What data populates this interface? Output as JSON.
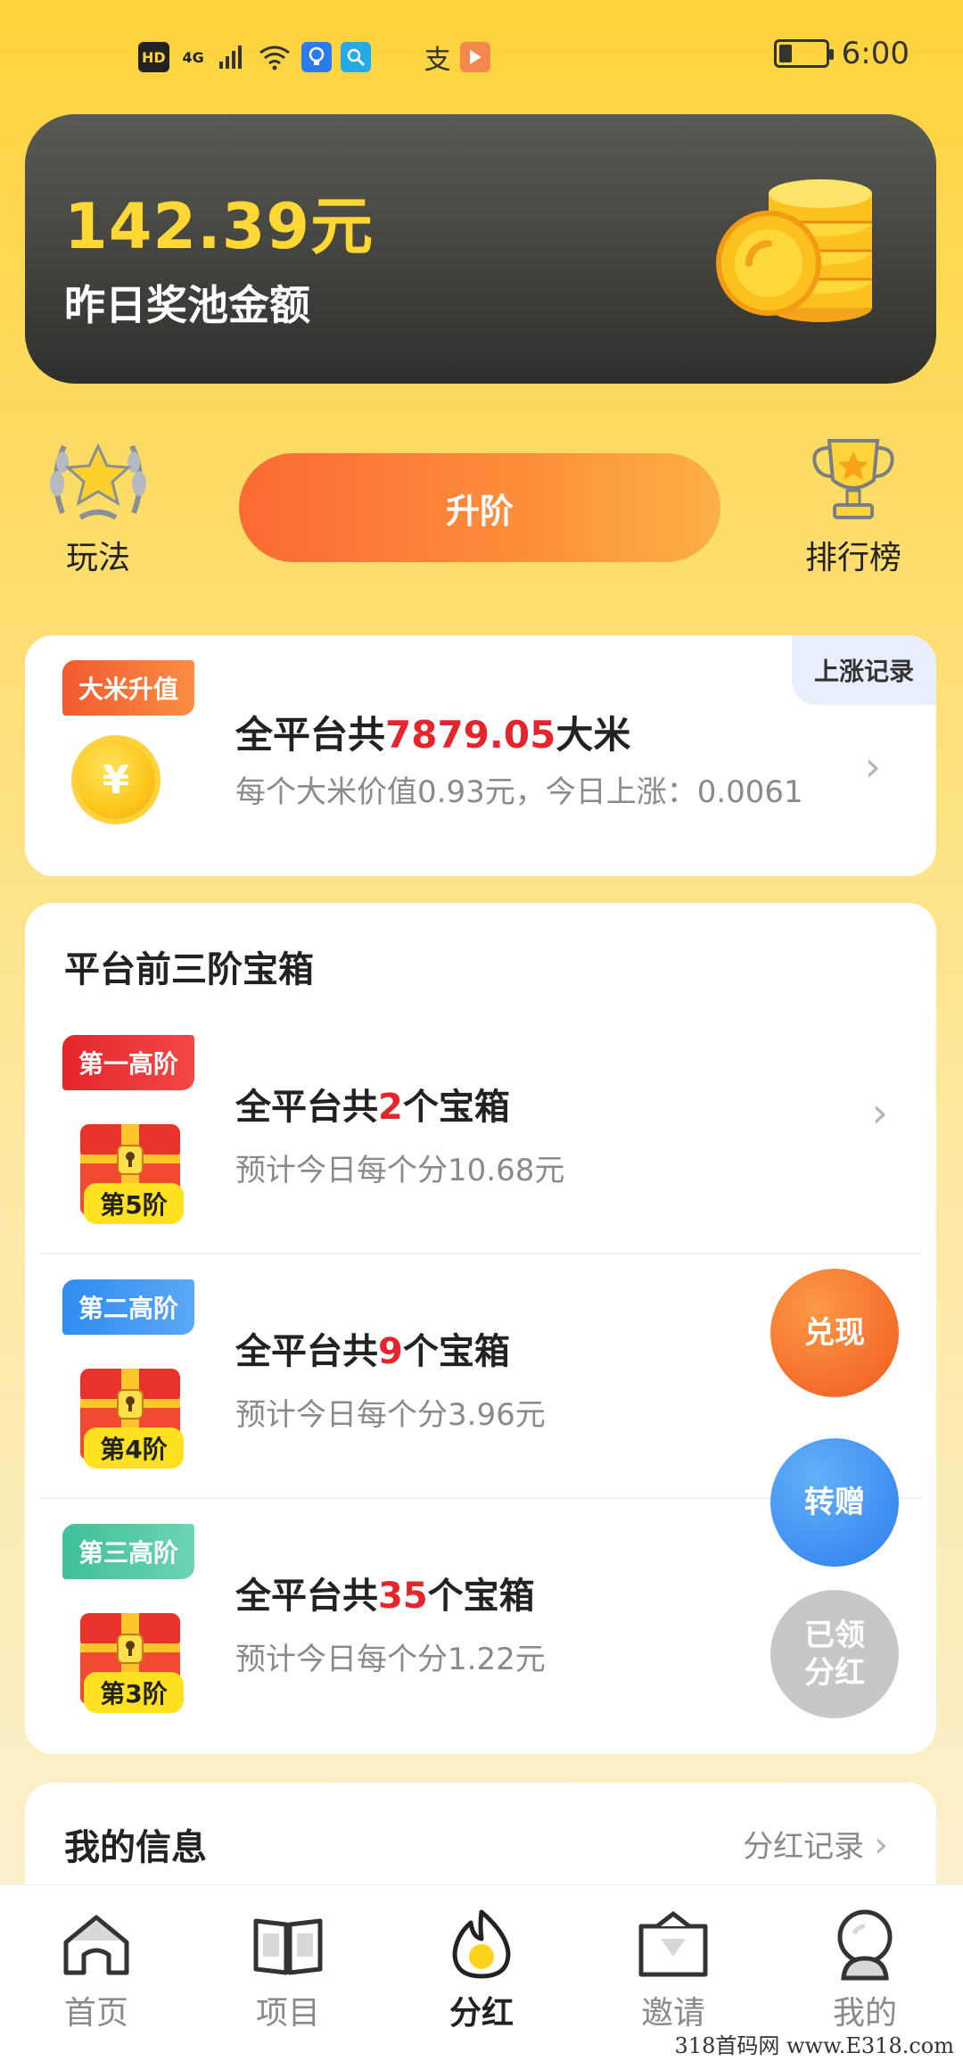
{
  "status_bar": {
    "left_badges": [
      "HD",
      "4G",
      "支"
    ],
    "time": "6:00"
  },
  "pool": {
    "amount": "142.39元",
    "label": "昨日奖池金额"
  },
  "actions": {
    "rules_label": "玩法",
    "upgrade_label": "升阶",
    "ranking_label": "排行榜"
  },
  "rice": {
    "tag": "大米升值",
    "rise_record": "上涨记录",
    "title_prefix": "全平台共",
    "total": "7879.05",
    "title_suffix": "大米",
    "subtitle": "每个大米价值0.93元，今日上涨：0.0061"
  },
  "chests": {
    "section_title": "平台前三阶宝箱",
    "rows": [
      {
        "tag": "第一高阶",
        "level": "第5阶",
        "title_prefix": "全平台共",
        "count": "2",
        "title_suffix": "个宝箱",
        "subtitle": "预计今日每个分10.68元"
      },
      {
        "tag": "第二高阶",
        "level": "第4阶",
        "title_prefix": "全平台共",
        "count": "9",
        "title_suffix": "个宝箱",
        "subtitle": "预计今日每个分3.96元"
      },
      {
        "tag": "第三高阶",
        "level": "第3阶",
        "title_prefix": "全平台共",
        "count": "35",
        "title_suffix": "个宝箱",
        "subtitle": "预计今日每个分1.22元"
      }
    ]
  },
  "fabs": {
    "cash_out": "兑现",
    "transfer": "转赠",
    "claimed": "已领分红"
  },
  "my_info": {
    "title": "我的信息",
    "link": "分红记录"
  },
  "nav": {
    "items": [
      {
        "label": "首页"
      },
      {
        "label": "项目"
      },
      {
        "label": "分红"
      },
      {
        "label": "邀请"
      },
      {
        "label": "我的"
      }
    ]
  },
  "watermark": "318首码网 www.E318.com",
  "colors": {
    "accent_yellow": "#fdd33c",
    "accent_orange": "#fb6a33",
    "highlight_red": "#e4262c"
  }
}
